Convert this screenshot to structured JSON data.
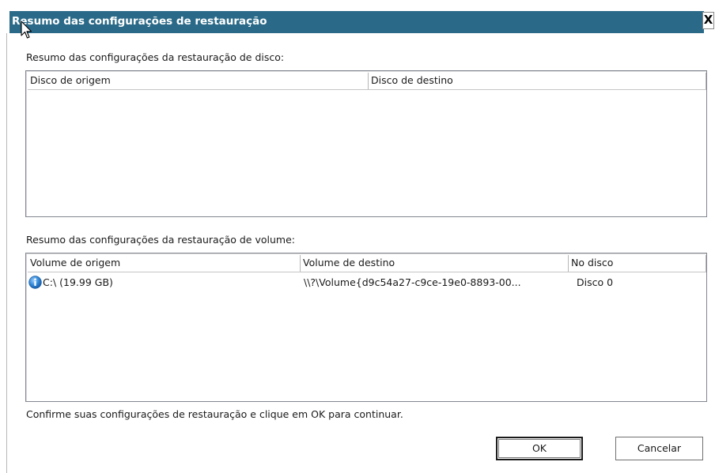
{
  "dialog": {
    "title": "Resumo das configurações de restauração",
    "close_label": "X"
  },
  "disk_section": {
    "label": "Resumo das configurações da restauração de disco:",
    "columns": [
      "Disco de origem",
      "Disco de destino"
    ],
    "rows": []
  },
  "volume_section": {
    "label": "Resumo das configurações da restauração de volume:",
    "columns": [
      "Volume de origem",
      "Volume de destino",
      "No disco"
    ],
    "rows": [
      {
        "icon": "info-icon",
        "source": "C:\\ (19.99 GB)",
        "destination": "\\\\?\\Volume{d9c54a27-c9ce-19e0-8893-00...",
        "disk": "Disco 0"
      }
    ]
  },
  "footer": {
    "message": "Confirme suas configurações de restauração e clique em OK para continuar."
  },
  "buttons": {
    "ok": "OK",
    "cancel": "Cancelar"
  },
  "colors": {
    "titlebar": "#2a6a88",
    "title_text": "#ffffff",
    "info_icon": "#2f86d6"
  }
}
